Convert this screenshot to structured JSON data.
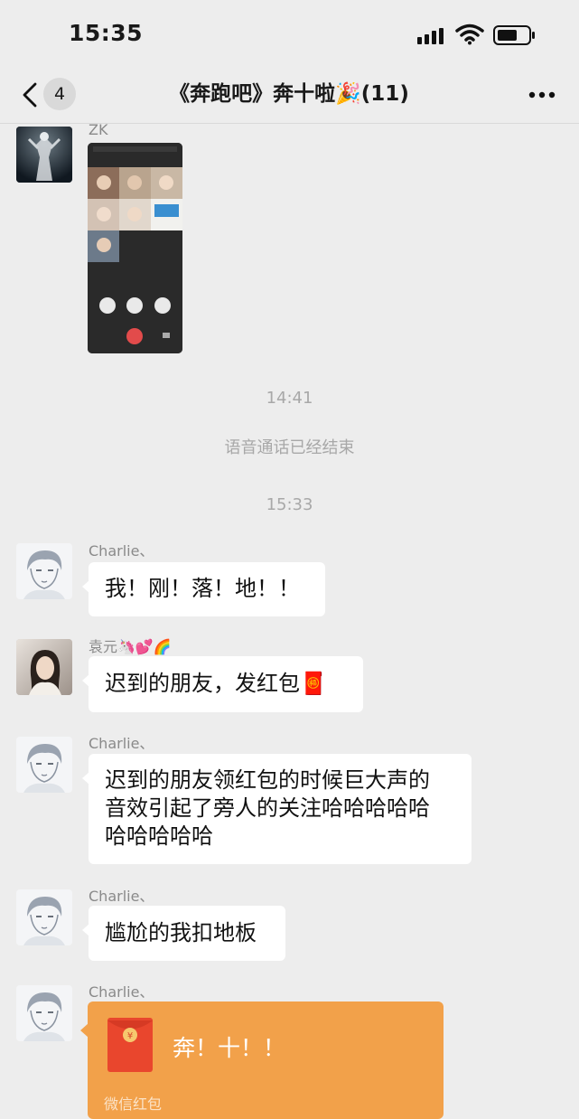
{
  "status_bar": {
    "time": "15:35"
  },
  "nav": {
    "unread_count": "4",
    "title": "《奔跑吧》奔十啦🎉(11)"
  },
  "messages": [
    {
      "sender": "ZK",
      "type": "image"
    },
    {
      "type": "time",
      "text": "14:41"
    },
    {
      "type": "system",
      "text": "语音通话已经结束"
    },
    {
      "type": "time",
      "text": "15:33"
    },
    {
      "sender": "Charlie、",
      "type": "text",
      "lines": [
        "我！刚！落！地！！"
      ]
    },
    {
      "sender": "袁元🦄💕🌈",
      "type": "text",
      "lines": [
        "迟到的朋友，发红包🧧"
      ]
    },
    {
      "sender": "Charlie、",
      "type": "text",
      "lines": [
        "迟到的朋友领红包的时候巨大声的",
        "音效引起了旁人的关注哈哈哈哈哈",
        "哈哈哈哈哈"
      ]
    },
    {
      "sender": "Charlie、",
      "type": "text",
      "lines": [
        "尴尬的我扣地板"
      ]
    },
    {
      "sender": "Charlie、",
      "type": "red_packet",
      "text": "奔！十！！",
      "label": "微信红包"
    }
  ],
  "icons": {
    "back": "chevron-left-icon",
    "more": "more-dots-icon",
    "signal": "cellular-signal-icon",
    "wifi": "wifi-icon",
    "battery": "battery-icon",
    "red_packet": "red-packet-icon"
  },
  "colors": {
    "background": "#ededed",
    "bubble": "#ffffff",
    "red_packet": "#f2a14a",
    "system_text": "#a8a8a8"
  }
}
